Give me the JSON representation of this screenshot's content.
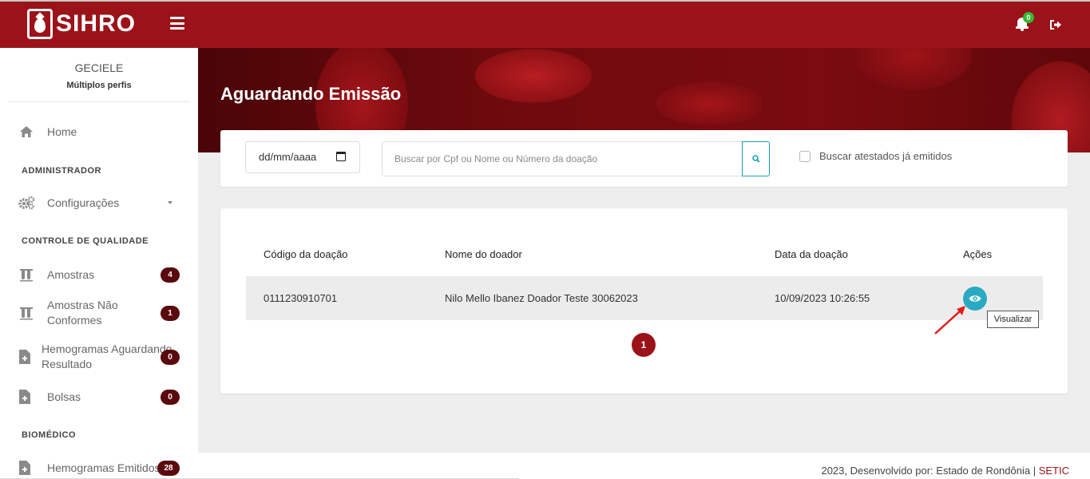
{
  "header": {
    "app_name": "SIHRO",
    "notification_count": "0"
  },
  "sidebar": {
    "user_name": "GECIELE",
    "user_role": "Múltiplos perfis",
    "home_label": "Home",
    "sections": {
      "admin": "ADMINISTRADOR",
      "quality": "CONTROLE DE QUALIDADE",
      "biomedic": "BIOMÉDICO"
    },
    "items": {
      "config": "Configurações",
      "samples": "Amostras",
      "samples_count": "4",
      "nonconforming_1": "Amostras Não",
      "nonconforming_2": "Conformes",
      "nonconforming_count": "1",
      "hemo_waiting_1": "Hemogramas Aguardando",
      "hemo_waiting_2": "Resultado",
      "hemo_waiting_count": "0",
      "bags": "Bolsas",
      "bags_count": "0",
      "hemo_issued": "Hemogramas Emitidos",
      "hemo_issued_count": "28"
    }
  },
  "page": {
    "title": "Aguardando Emissão"
  },
  "filters": {
    "date_placeholder": "dd/mm/aaaa",
    "search_placeholder": "Buscar por Cpf ou Nome ou Número da doação",
    "checkbox_label": "Buscar atestados já emitidos"
  },
  "table": {
    "headers": {
      "code": "Código da doação",
      "name": "Nome do doador",
      "date": "Data da doação",
      "actions": "Ações"
    },
    "rows": [
      {
        "code": "0111230910701",
        "name": "Nilo Mello Ibanez Doador Teste 30062023",
        "date": "10/09/2023 10:26:55"
      }
    ],
    "tooltip": "Visualizar"
  },
  "pagination": {
    "current": "1"
  },
  "footer": {
    "text": "2023, Desenvolvido por: Estado de Rondônia | ",
    "link": "SETIC"
  },
  "colors": {
    "brand": "#9b1319",
    "badge": "#5a0a0d",
    "accent": "#2aa9c2",
    "notification": "#35b932"
  }
}
